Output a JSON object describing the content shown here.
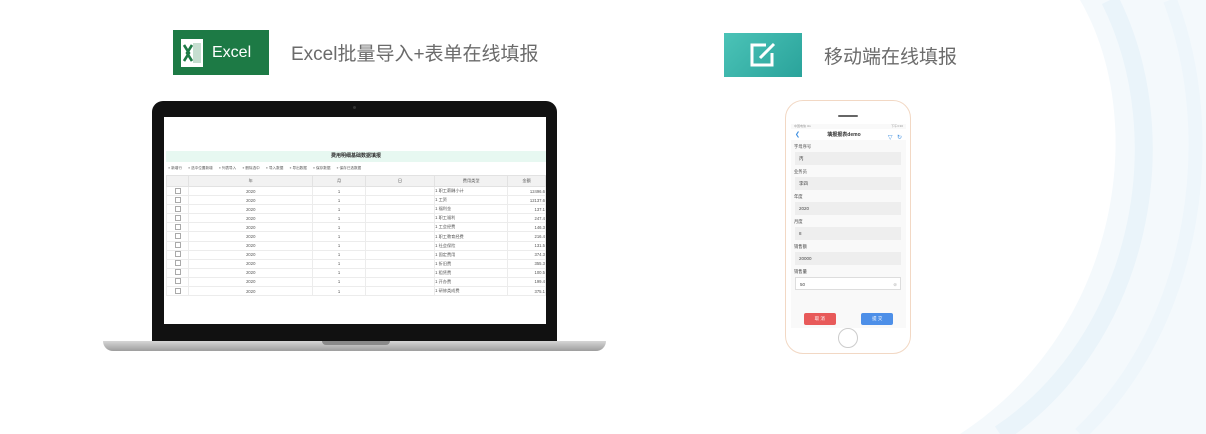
{
  "excel_section": {
    "logo_text": "Excel",
    "title": "Excel批量导入+表单在线填报"
  },
  "mobile_section": {
    "title": "移动端在线填报"
  },
  "spreadsheet": {
    "title": "费用明细基础数据填报",
    "toolbar": [
      "新增行",
      "选中位置新增",
      "列表导入",
      "删除选中",
      "导入数据",
      "导出数据",
      "保存数据",
      "保存已选数据"
    ],
    "columns": [
      "年",
      "月",
      "日",
      "费用类型",
      "金额"
    ],
    "rows": [
      [
        "2020",
        "1",
        "",
        "1 职工薪酬小计",
        "12496.6"
      ],
      [
        "2020",
        "1",
        "",
        "1 工资",
        "12137.6"
      ],
      [
        "2020",
        "1",
        "",
        "1 福利金",
        "137.1"
      ],
      [
        "2020",
        "1",
        "",
        "1 职工福利",
        "247.4"
      ],
      [
        "2020",
        "1",
        "",
        "1 工会经费",
        "146.3"
      ],
      [
        "2020",
        "1",
        "",
        "1 职工教育经费",
        "216.4"
      ],
      [
        "2020",
        "1",
        "",
        "1 社会保险",
        "131.5"
      ],
      [
        "2020",
        "1",
        "",
        "1 固定费用",
        "374.3"
      ],
      [
        "2020",
        "1",
        "",
        "1 折旧费",
        "355.3"
      ],
      [
        "2020",
        "1",
        "",
        "1 租赁费",
        "100.5"
      ],
      [
        "2020",
        "1",
        "",
        "1 开办费",
        "199.4"
      ],
      [
        "2020",
        "1",
        "",
        "1 研修类成费",
        "375.1"
      ]
    ]
  },
  "phone_form": {
    "status_left": "中国电信 4G",
    "status_right": "下午3:30",
    "title": "填报报表demo",
    "fields": [
      {
        "label": "字母序号",
        "value": "丙"
      },
      {
        "label": "业务员",
        "value": "李四"
      },
      {
        "label": "年度",
        "value": "2020"
      },
      {
        "label": "月度",
        "value": "8"
      },
      {
        "label": "销售额",
        "value": "20000"
      },
      {
        "label": "销售量",
        "value": "50"
      }
    ],
    "cancel_label": "取 消",
    "submit_label": "提 交"
  },
  "colors": {
    "excel_green": "#1d7a45",
    "edit_teal": "#2aa39b",
    "cancel_red": "#e85a5a",
    "submit_blue": "#4d8fe8"
  }
}
